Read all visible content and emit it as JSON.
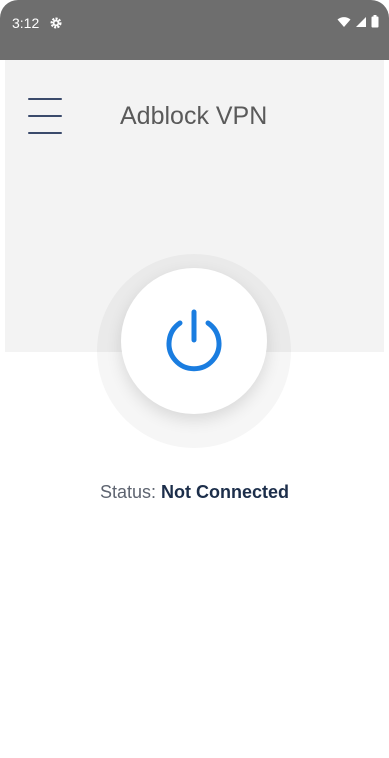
{
  "status_bar": {
    "time": "3:12",
    "icons": [
      "gear-icon",
      "wifi-icon",
      "signal-icon",
      "battery-icon"
    ]
  },
  "app": {
    "title": "Adblock VPN",
    "menu_icon": "hamburger-menu-icon",
    "power_icon": "power-icon",
    "status_label": "Status:",
    "status_value": "Not Connected"
  },
  "colors": {
    "status_bar_bg": "#6e6e6e",
    "header_bg": "#f3f3f3",
    "accent": "#1a7de0",
    "status_value": "#1c2e4a"
  }
}
